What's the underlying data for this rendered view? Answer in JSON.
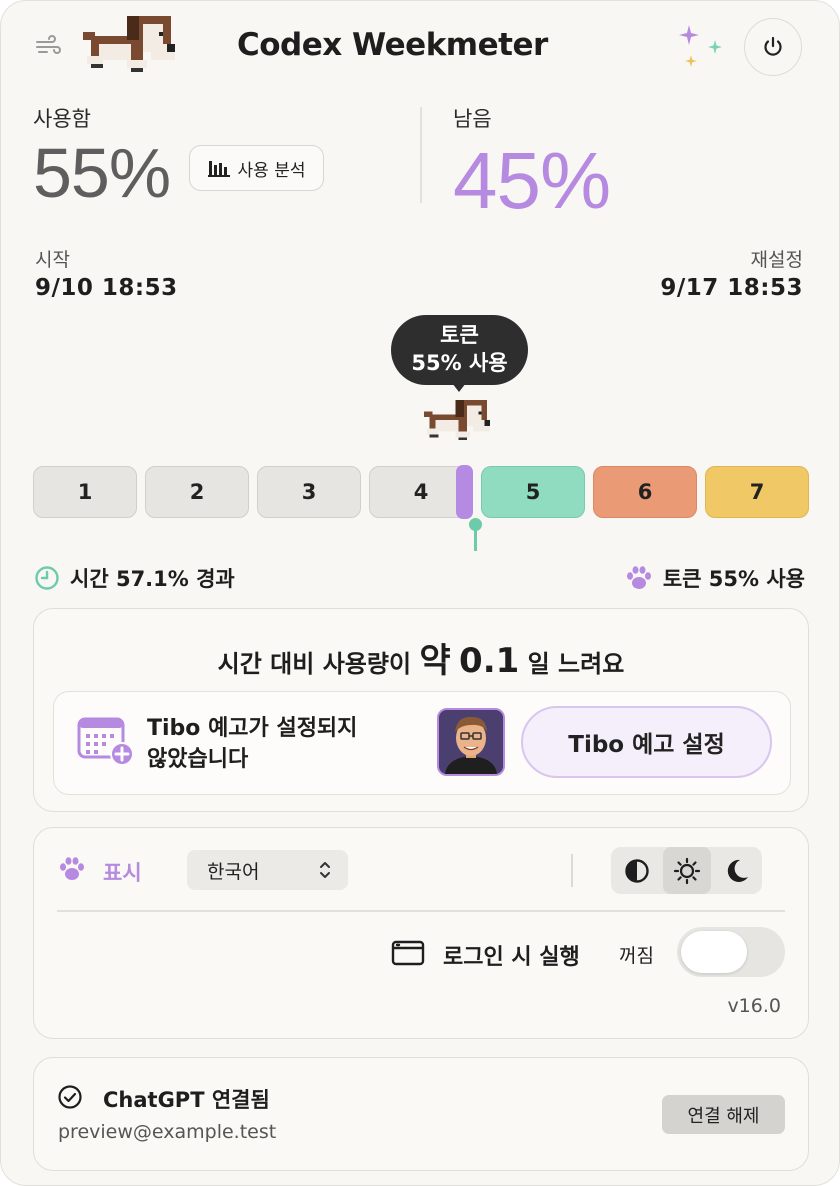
{
  "header": {
    "title": "Codex Weekmeter"
  },
  "usage": {
    "used_label": "사용함",
    "used_value": "55%",
    "analysis_label": "사용 분석",
    "remaining_label": "남음",
    "remaining_value": "45%"
  },
  "period": {
    "start_label": "시작",
    "start_value": "9/10 18:53",
    "reset_label": "재설정",
    "reset_value": "9/17 18:53"
  },
  "tooltip": {
    "line1": "토큰",
    "line2": "55% 사용"
  },
  "days": [
    {
      "label": "1",
      "color": "#e6e5e1"
    },
    {
      "label": "2",
      "color": "#e6e5e1"
    },
    {
      "label": "3",
      "color": "#e6e5e1"
    },
    {
      "label": "4",
      "color": "#e6e5e1"
    },
    {
      "label": "5",
      "color": "#8fdcc1"
    },
    {
      "label": "6",
      "color": "#eb9a76"
    },
    {
      "label": "7",
      "color": "#f1c866"
    }
  ],
  "progress": {
    "time_fraction": 0.571,
    "token_fraction": 0.55
  },
  "stats": {
    "time_text": "시간 57.1% 경과",
    "token_text": "토큰 55% 사용"
  },
  "pace": {
    "prefix": "시간 대비 사용량이",
    "value_prefix": "약",
    "value": "0.1",
    "suffix": "일 느려요"
  },
  "tibo": {
    "message_line1": "Tibo 예고가 설정되지",
    "message_line2": "않았습니다",
    "button_label": "Tibo 예고 설정"
  },
  "settings": {
    "display_label": "표시",
    "language_value": "한국어",
    "theme_selected": "light",
    "login_label": "로그인 시 실행",
    "login_state": "꺼짐",
    "version": "v16.0"
  },
  "account": {
    "status_label": "ChatGPT 연결됨",
    "email": "preview@example.test",
    "disconnect_label": "연결 해제"
  },
  "colors": {
    "accent_purple": "#b58ae0",
    "teal": "#6ccba9",
    "background": "#f8f7f3"
  }
}
